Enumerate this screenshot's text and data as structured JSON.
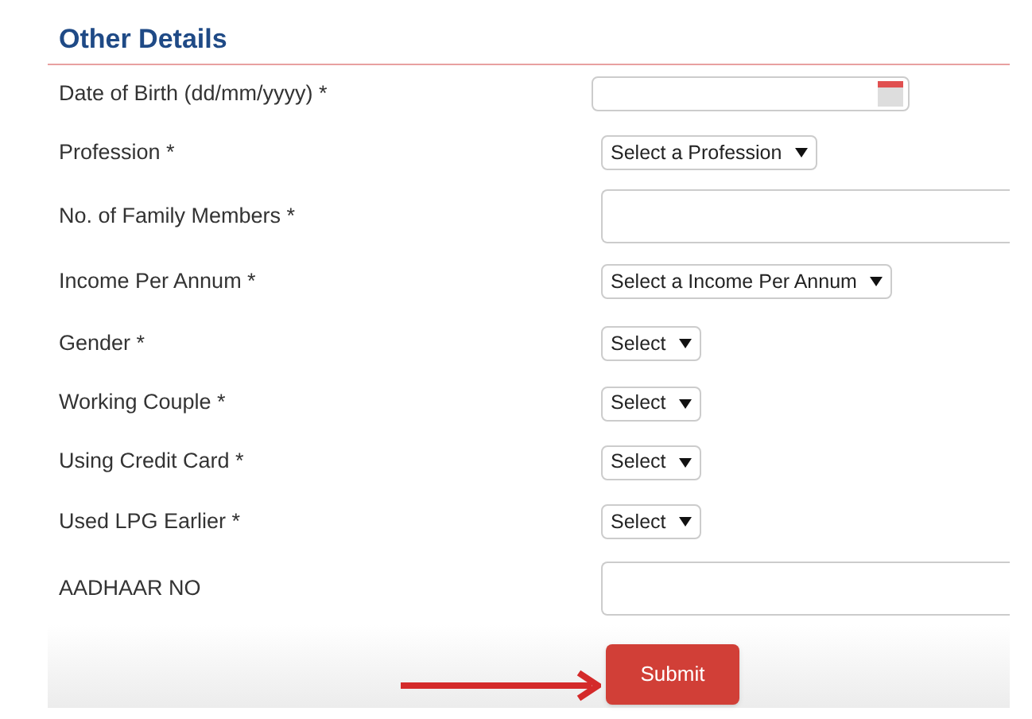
{
  "section": {
    "title": "Other Details"
  },
  "fields": [
    {
      "label": "Date of Birth (dd/mm/yyyy) *",
      "kind": "date"
    },
    {
      "label": "Profession *",
      "kind": "select",
      "value": "Select a Profession"
    },
    {
      "label": "No. of Family Members *",
      "kind": "text"
    },
    {
      "label": "Income Per Annum *",
      "kind": "select",
      "value": "Select a Income Per Annum"
    },
    {
      "label": "Gender *",
      "kind": "select",
      "value": "Select"
    },
    {
      "label": "Working Couple *",
      "kind": "select",
      "value": "Select"
    },
    {
      "label": "Using Credit Card *",
      "kind": "select",
      "value": "Select"
    },
    {
      "label": "Used LPG Earlier *",
      "kind": "select",
      "value": "Select"
    },
    {
      "label": "AADHAAR NO",
      "kind": "text"
    }
  ],
  "submit": {
    "label": "Submit"
  }
}
